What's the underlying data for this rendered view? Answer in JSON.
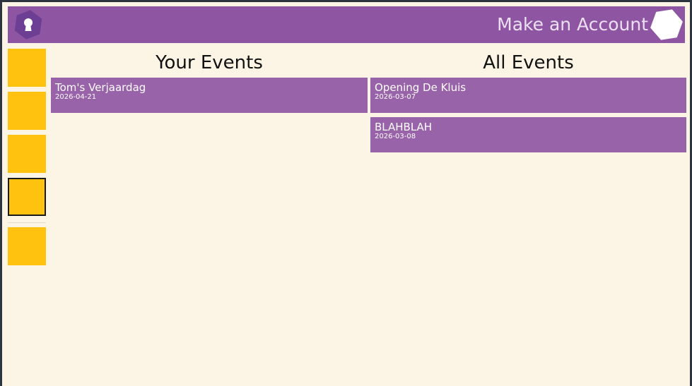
{
  "header": {
    "title": "Make an Account",
    "logo_icon": "keyhole-hexagon-icon",
    "account_icon": "hexagon-icon"
  },
  "sidebar": {
    "items": [
      {
        "icon": "yellow-square"
      },
      {
        "icon": "yellow-square"
      },
      {
        "icon": "yellow-square"
      },
      {
        "icon": "yellow-square",
        "active": true
      },
      {
        "icon": "yellow-square"
      }
    ]
  },
  "your_events": {
    "title": "Your Events",
    "items": [
      {
        "name": "Tom's Verjaardag",
        "date": "2026-04-21"
      }
    ]
  },
  "all_events": {
    "title": "All Events",
    "items": [
      {
        "name": "Opening De Kluis",
        "date": "2026-03-07"
      },
      {
        "name": "BLAHBLAH",
        "date": "2026-03-08"
      }
    ]
  },
  "colors": {
    "header_bg": "#8e56a2",
    "card_bg": "#9963aa",
    "page_bg": "#fcf5e5",
    "sidebar_button": "#fec20f",
    "logo_hex": "#6d3f94"
  }
}
